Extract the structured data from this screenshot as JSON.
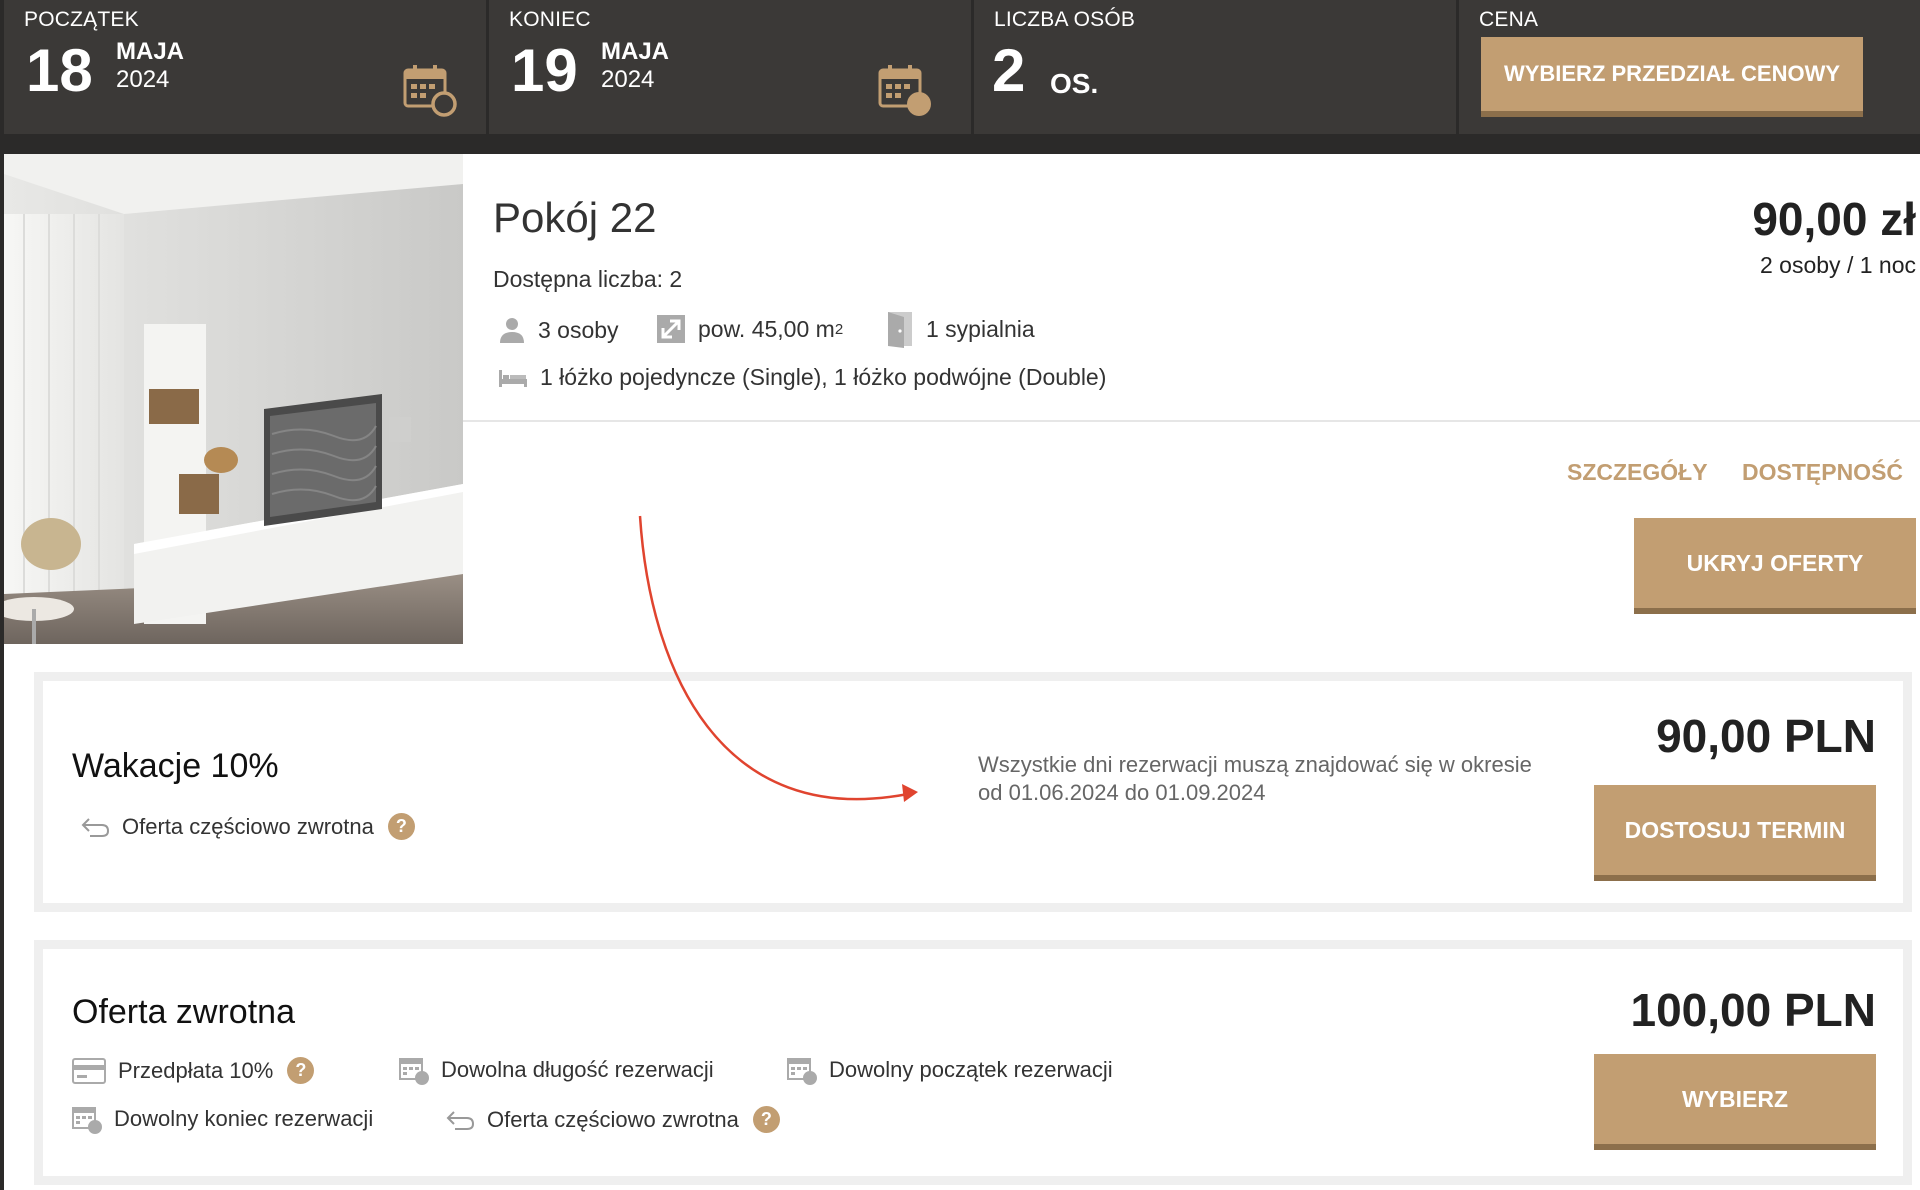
{
  "search": {
    "start": {
      "label": "POCZĄTEK",
      "day": "18",
      "month": "MAJA",
      "year": "2024"
    },
    "end": {
      "label": "KONIEC",
      "day": "19",
      "month": "MAJA",
      "year": "2024"
    },
    "persons": {
      "label": "LICZBA OSÓB",
      "count": "2",
      "unit": "OS."
    },
    "price": {
      "label": "CENA",
      "button": "WYBIERZ PRZEDZIAŁ CENOWY"
    }
  },
  "room": {
    "title": "Pokój 22",
    "availability": "Dostępna liczba: 2",
    "features": {
      "persons": "3 osoby",
      "area": "pow. 45,00 m",
      "area_sup": "2",
      "bedrooms": "1 sypialnia",
      "beds": "1 łóżko pojedyncze (Single), 1 łóżko podwójne (Double)"
    },
    "price": "90,00 zł",
    "price_sub": "2 osoby / 1 noc",
    "links": {
      "details": "SZCZEGÓŁY",
      "availability": "DOSTĘPNOŚĆ"
    },
    "hide_button": "UKRYJ OFERTY"
  },
  "offers": [
    {
      "title": "Wakacje 10%",
      "feature_refund": "Oferta częściowo zwrotna",
      "help": "?",
      "note": "Wszystkie dni rezerwacji muszą znajdować się w okresie od 01.06.2024 do 01.09.2024",
      "price": "90,00 PLN",
      "button": "DOSTOSUJ TERMIN"
    },
    {
      "title": "Oferta zwrotna",
      "feature_prepay": "Przedpłata 10%",
      "feature_length": "Dowolna długość rezerwacji",
      "feature_start": "Dowolny początek rezerwacji",
      "feature_end": "Dowolny koniec rezerwacji",
      "feature_refund": "Oferta częściowo zwrotna",
      "help": "?",
      "price": "100,00 PLN",
      "button": "WYBIERZ"
    }
  ],
  "colors": {
    "accent": "#c29e72",
    "accent_dark": "#8c6f4b",
    "bar": "#3b3937",
    "arrow": "#e0442f"
  }
}
